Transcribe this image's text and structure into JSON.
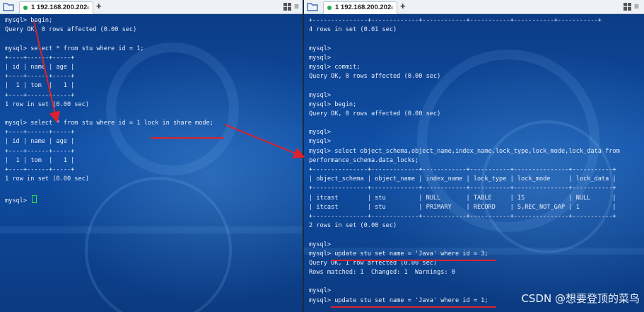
{
  "left": {
    "tab_label": "1 192.168.200.202",
    "lines": [
      "mysql> begin;",
      "Query OK, 0 rows affected (0.00 sec)",
      "",
      "mysql> select * from stu where id = 1;",
      "+----+------+-----+",
      "| id | name | age |",
      "+----+------+-----+",
      "|  1 | tom  |   1 |",
      "+----+------+-----+",
      "1 row in set (0.00 sec)",
      "",
      "mysql> select * from stu where id = 1 lock in share mode;",
      "+----+------+-----+",
      "| id | name | age |",
      "+----+------+-----+",
      "|  1 | tom  |   1 |",
      "+----+------+-----+",
      "1 row in set (0.00 sec)",
      "",
      "mysql> "
    ]
  },
  "right": {
    "tab_label": "1 192.168.200.202",
    "lines": [
      "+---------------+-------------+------------+-----------+-----------+-----------+",
      "4 rows in set (0.01 sec)",
      "",
      "mysql>",
      "mysql>",
      "mysql> commit;",
      "Query OK, 0 rows affected (0.00 sec)",
      "",
      "mysql>",
      "mysql> begin;",
      "Query OK, 0 rows affected (0.00 sec)",
      "",
      "mysql>",
      "mysql>",
      "mysql> select object_schema,object_name,index_name,lock_type,lock_mode,lock_data from",
      "performance_schema.data_locks;",
      "+---------------+-------------+------------+-----------+---------------+-----------+",
      "| object_schema | object_name | index_name | lock_type | lock_mode     | lock_data |",
      "+---------------+-------------+------------+-----------+---------------+-----------+",
      "| itcast        | stu         | NULL       | TABLE     | IS            | NULL      |",
      "| itcast        | stu         | PRIMARY    | RECORD    | S,REC_NOT_GAP | 1         |",
      "+---------------+-------------+------------+-----------+---------------+-----------+",
      "2 rows in set (0.00 sec)",
      "",
      "mysql>",
      "mysql> update stu set name = 'Java' where id = 3;",
      "Query OK, 1 row affected (0.00 sec)",
      "Rows matched: 1  Changed: 1  Warnings: 0",
      "",
      "mysql>",
      "mysql> update stu set name = 'Java' where id = 1;"
    ]
  },
  "watermark": "CSDN @想要登顶的菜鸟",
  "colors": {
    "terminal_bg": "#0f4fa6",
    "text": "#e8eef8",
    "tab_active_dot": "#27a844",
    "annotation_red": "#e0202a"
  },
  "icons": [
    "folder-icon",
    "add-tab-icon",
    "grid-view-icon",
    "menu-icon"
  ]
}
